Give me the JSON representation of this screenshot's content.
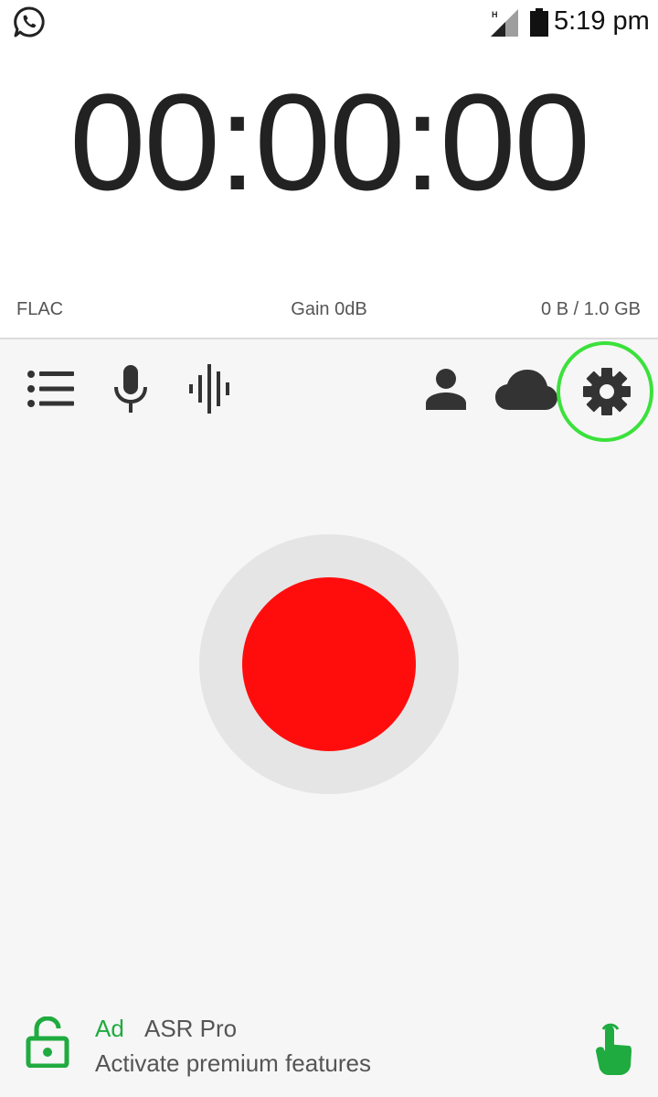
{
  "status_bar": {
    "time": "5:19 pm",
    "network_label": "H",
    "icons": [
      "whatsapp-icon",
      "signal-icon",
      "battery-icon"
    ]
  },
  "timer": {
    "value": "00:00:00"
  },
  "info": {
    "format": "FLAC",
    "gain": "Gain 0dB",
    "storage": "0 B / 1.0 GB"
  },
  "toolbar": {
    "left_icons": [
      "list-icon",
      "microphone-icon",
      "waveform-icon"
    ],
    "right_icons": [
      "person-icon",
      "cloud-icon",
      "gear-icon"
    ],
    "highlight_color": "#3be13b"
  },
  "record": {
    "button_color": "#ff0d0d",
    "ring_color": "#e5e5e5"
  },
  "ad": {
    "tag": "Ad",
    "title": "ASR Pro",
    "subtitle": "Activate premium features",
    "accent_color": "#1fab3f",
    "icons": [
      "unlock-icon",
      "tap-hand-icon"
    ]
  }
}
